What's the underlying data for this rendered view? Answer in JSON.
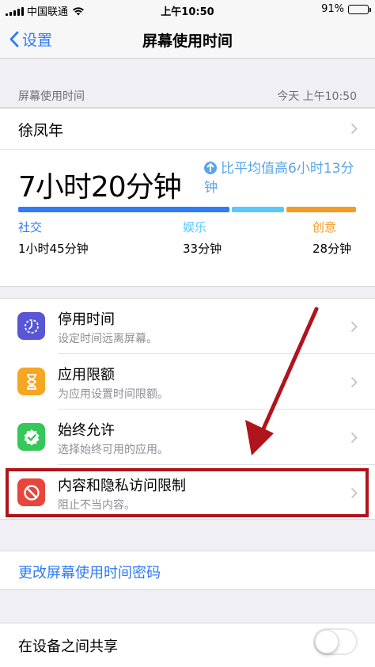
{
  "status_bar": {
    "carrier": "中国联通",
    "time": "上午10:50",
    "battery": "91%",
    "battery_level": 0.91
  },
  "nav": {
    "back_label": "设置",
    "title": "屏幕使用时间"
  },
  "section": {
    "label": "屏幕使用时间",
    "updated": "今天 上午10:50"
  },
  "user": {
    "name": "徐凤年"
  },
  "usage": {
    "total": "7小时20分钟",
    "compare": "比平均值高6小时13分钟",
    "categories": [
      {
        "label": "社交",
        "value": "1小时45分钟",
        "color": "#2f7cf6"
      },
      {
        "label": "娱乐",
        "value": "33分钟",
        "color": "#5ac8fa"
      },
      {
        "label": "创意",
        "value": "28分钟",
        "color": "#f59a23"
      }
    ]
  },
  "menu": [
    {
      "title": "停用时间",
      "subtitle": "设定时间远离屏幕。",
      "icon": "moon-clock-icon",
      "color": "#5856d6"
    },
    {
      "title": "应用限额",
      "subtitle": "为应用设置时间限额。",
      "icon": "hourglass-icon",
      "color": "#f5a623"
    },
    {
      "title": "始终允许",
      "subtitle": "选择始终可用的应用。",
      "icon": "checkmark-badge-icon",
      "color": "#34c759"
    },
    {
      "title": "内容和隐私访问限制",
      "subtitle": "阻止不当内容。",
      "icon": "prohibited-icon",
      "color": "#e8453c"
    }
  ],
  "passcode_link": "更改屏幕使用时间密码",
  "share": {
    "label": "在设备之间共享",
    "enabled": false
  },
  "annotation_color": "#b0141c"
}
